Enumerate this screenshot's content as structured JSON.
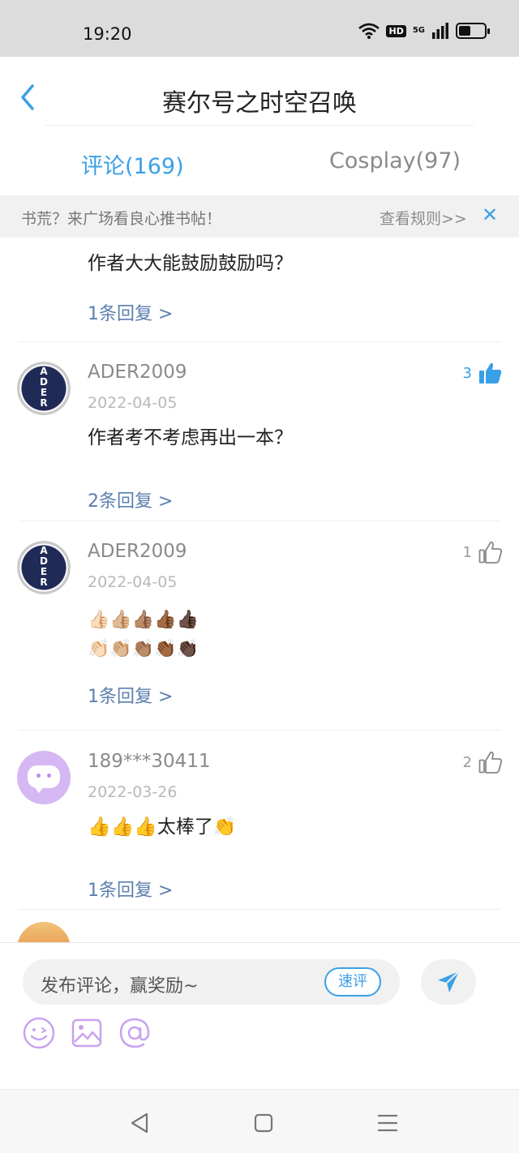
{
  "status_bar": {
    "time": "19:20",
    "hd_label": "HD",
    "network_label": "5G",
    "battery_level": 0.45
  },
  "header": {
    "title": "赛尔号之时空召唤"
  },
  "tabs": [
    {
      "label": "评论(169)",
      "active": true
    },
    {
      "label": "Cosplay(97)",
      "active": false
    }
  ],
  "banner": {
    "text": "书荒？来广场看良心推书帖！",
    "rules_link": "查看规则>>",
    "close_icon": "close-icon"
  },
  "partial_comment": {
    "line": "作者大大能鼓励鼓励吗？",
    "reply_link": "1条回复 >"
  },
  "comments": [
    {
      "username": "ADER2009",
      "avatar_text": "ADER",
      "date": "2022-04-05",
      "text": "作者考不考虑再出一本？",
      "likes": "3",
      "liked": true,
      "reply_link": "2条回复 >"
    },
    {
      "username": "ADER2009",
      "avatar_text": "ADER",
      "date": "2022-04-05",
      "text_line1": "👍🏻👍🏼👍🏽👍🏾👍🏿",
      "text_line2": "👏🏻👏🏼👏🏽👏🏾👏🏿",
      "likes": "1",
      "liked": false,
      "reply_link": "1条回复 >"
    },
    {
      "username": "189***30411",
      "date": "2022-03-26",
      "text": "👍👍👍太棒了👏",
      "likes": "2",
      "liked": false,
      "reply_link": "1条回复 >"
    }
  ],
  "composer": {
    "placeholder": "发布评论，赢奖励~",
    "quick_review": "速评",
    "send_icon": "send-icon",
    "tools": [
      "emoji-icon",
      "image-icon",
      "at-icon"
    ]
  },
  "nav_bar": {
    "buttons": [
      "back-triangle-icon",
      "home-square-icon",
      "menu-lines-icon"
    ]
  },
  "colors": {
    "accent": "#3aa0e6",
    "link": "#5b7fae",
    "purple": "#c18be8"
  }
}
